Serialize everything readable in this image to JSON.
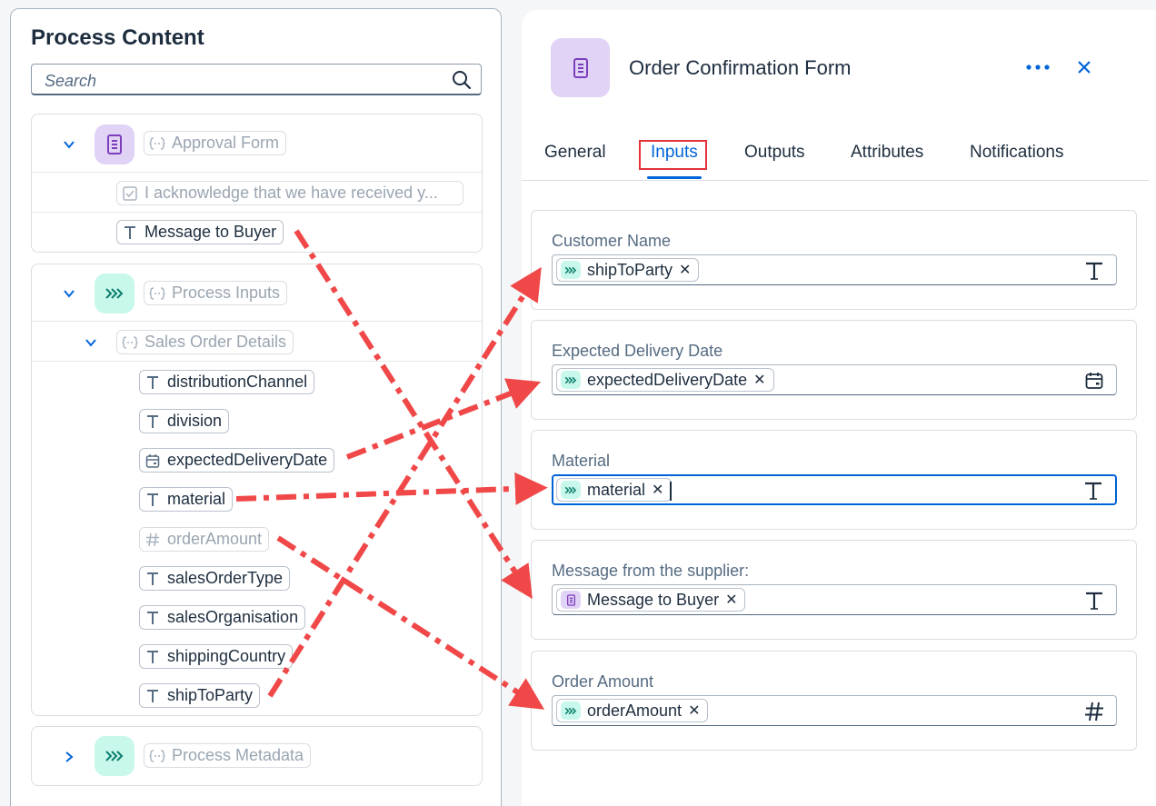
{
  "left": {
    "title": "Process Content",
    "search_placeholder": "Search",
    "groups": {
      "approval": {
        "label": "Approval Form",
        "items": [
          "I acknowledge that we have received y...",
          "Message to Buyer"
        ]
      },
      "inputs": {
        "label": "Process Inputs",
        "sub_label": "Sales Order Details",
        "items": [
          "distributionChannel",
          "division",
          "expectedDeliveryDate",
          "material",
          "orderAmount",
          "salesOrderType",
          "salesOrganisation",
          "shippingCountry",
          "shipToParty"
        ]
      },
      "metadata": {
        "label": "Process Metadata"
      }
    }
  },
  "form": {
    "title": "Order Confirmation Form",
    "tabs": [
      "General",
      "Inputs",
      "Outputs",
      "Attributes",
      "Notifications"
    ],
    "active_tab": "Inputs",
    "fields": [
      {
        "label": "Customer Name",
        "token": "shipToParty",
        "source": "process-input",
        "type": "text"
      },
      {
        "label": "Expected Delivery Date",
        "token": "expectedDeliveryDate",
        "source": "process-input",
        "type": "date"
      },
      {
        "label": "Material",
        "token": "material",
        "source": "process-input",
        "type": "text"
      },
      {
        "label": "Message from the supplier:",
        "token": "Message to Buyer",
        "source": "form",
        "type": "text"
      },
      {
        "label": "Order Amount",
        "token": "orderAmount",
        "source": "process-input",
        "type": "number"
      }
    ]
  },
  "colors": {
    "accent": "#0064d9",
    "highlight_red": "#e3323a",
    "arrow_red": "#f04848",
    "form_purple": "#e1d3f6",
    "input_teal": "#c8f7ec"
  }
}
